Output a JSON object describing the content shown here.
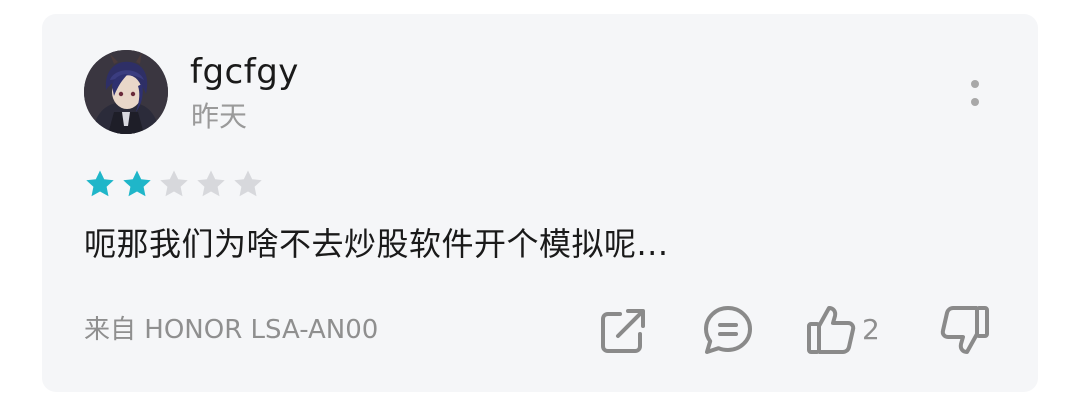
{
  "comment": {
    "username": "fgcfgy",
    "time": "昨天",
    "rating": 2,
    "rating_max": 5,
    "text": "呃那我们为啥不去炒股软件开个模拟呢...",
    "source": "来自 HONOR LSA-AN00",
    "like_count": "2"
  },
  "colors": {
    "star_filled": "#1fb6c9",
    "star_empty": "#d7d8dc",
    "icon": "#8a8a8a",
    "card_bg": "#f5f6f8"
  },
  "icons": {
    "more": "more-vertical-icon",
    "share": "share-icon",
    "reply": "comment-icon",
    "like": "thumbs-up-icon",
    "dislike": "thumbs-down-icon"
  }
}
